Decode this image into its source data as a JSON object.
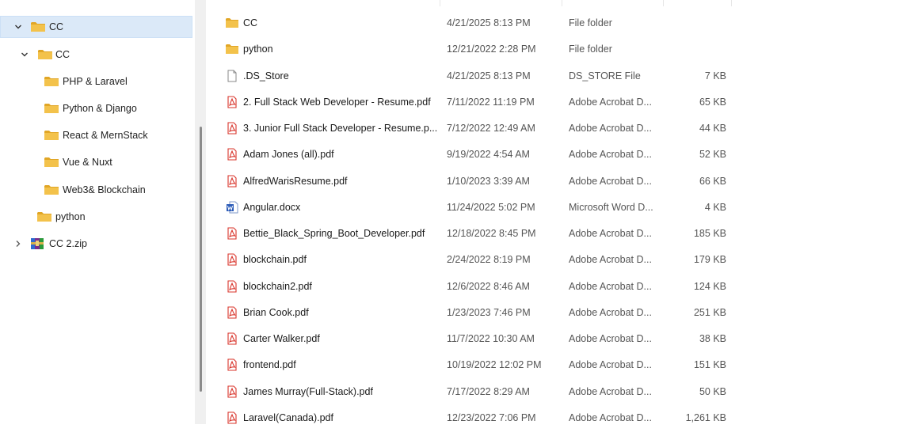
{
  "nav": {
    "items": [
      {
        "label": "CC",
        "icon": "folder-icon",
        "expanded": true,
        "selected": true
      },
      {
        "label": "CC",
        "icon": "folder-icon",
        "expanded": true
      },
      {
        "label": "PHP & Laravel",
        "icon": "folder-icon"
      },
      {
        "label": "Python & Django",
        "icon": "folder-icon"
      },
      {
        "label": "React & MernStack",
        "icon": "folder-icon"
      },
      {
        "label": "Vue & Nuxt",
        "icon": "folder-icon"
      },
      {
        "label": "Web3& Blockchain",
        "icon": "folder-icon"
      },
      {
        "label": "python",
        "icon": "folder-icon"
      },
      {
        "label": "CC 2.zip",
        "icon": "winrar-archive-icon",
        "expanded": false
      }
    ]
  },
  "files": [
    {
      "name": "CC",
      "date": "4/21/2025 8:13 PM",
      "type": "File folder",
      "size": "",
      "icon": "folder-icon"
    },
    {
      "name": "python",
      "date": "12/21/2022 2:28 PM",
      "type": "File folder",
      "size": "",
      "icon": "folder-icon"
    },
    {
      "name": ".DS_Store",
      "date": "4/21/2025 8:13 PM",
      "type": "DS_STORE File",
      "size": "7 KB",
      "icon": "file-icon"
    },
    {
      "name": "2. Full Stack Web Developer - Resume.pdf",
      "date": "7/11/2022 11:19 PM",
      "type": "Adobe Acrobat D...",
      "size": "65 KB",
      "icon": "pdf-icon"
    },
    {
      "name": "3. Junior Full Stack Developer - Resume.p...",
      "date": "7/12/2022 12:49 AM",
      "type": "Adobe Acrobat D...",
      "size": "44 KB",
      "icon": "pdf-icon"
    },
    {
      "name": "Adam Jones (all).pdf",
      "date": "9/19/2022 4:54 AM",
      "type": "Adobe Acrobat D...",
      "size": "52 KB",
      "icon": "pdf-icon"
    },
    {
      "name": "AlfredWarisResume.pdf",
      "date": "1/10/2023 3:39 AM",
      "type": "Adobe Acrobat D...",
      "size": "66 KB",
      "icon": "pdf-icon"
    },
    {
      "name": "Angular.docx",
      "date": "11/24/2022 5:02 PM",
      "type": "Microsoft Word D...",
      "size": "4 KB",
      "icon": "word-icon"
    },
    {
      "name": "Bettie_Black_Spring_Boot_Developer.pdf",
      "date": "12/18/2022 8:45 PM",
      "type": "Adobe Acrobat D...",
      "size": "185 KB",
      "icon": "pdf-icon"
    },
    {
      "name": "blockchain.pdf",
      "date": "2/24/2022 8:19 PM",
      "type": "Adobe Acrobat D...",
      "size": "179 KB",
      "icon": "pdf-icon"
    },
    {
      "name": "blockchain2.pdf",
      "date": "12/6/2022 8:46 AM",
      "type": "Adobe Acrobat D...",
      "size": "124 KB",
      "icon": "pdf-icon"
    },
    {
      "name": "Brian Cook.pdf",
      "date": "1/23/2023 7:46 PM",
      "type": "Adobe Acrobat D...",
      "size": "251 KB",
      "icon": "pdf-icon"
    },
    {
      "name": "Carter Walker.pdf",
      "date": "11/7/2022 10:30 AM",
      "type": "Adobe Acrobat D...",
      "size": "38 KB",
      "icon": "pdf-icon"
    },
    {
      "name": "frontend.pdf",
      "date": "10/19/2022 12:02 PM",
      "type": "Adobe Acrobat D...",
      "size": "151 KB",
      "icon": "pdf-icon"
    },
    {
      "name": "James Murray(Full-Stack).pdf",
      "date": "7/17/2022 8:29 AM",
      "type": "Adobe Acrobat D...",
      "size": "50 KB",
      "icon": "pdf-icon"
    },
    {
      "name": "Laravel(Canada).pdf",
      "date": "12/23/2022 7:06 PM",
      "type": "Adobe Acrobat D...",
      "size": "1,261 KB",
      "icon": "pdf-icon"
    }
  ],
  "colors": {
    "folder": "#f3c24b",
    "folder_dark": "#e1a626",
    "pdf": "#d9342b",
    "word": "#2b5bb8",
    "selection": "#dbe9f8"
  }
}
